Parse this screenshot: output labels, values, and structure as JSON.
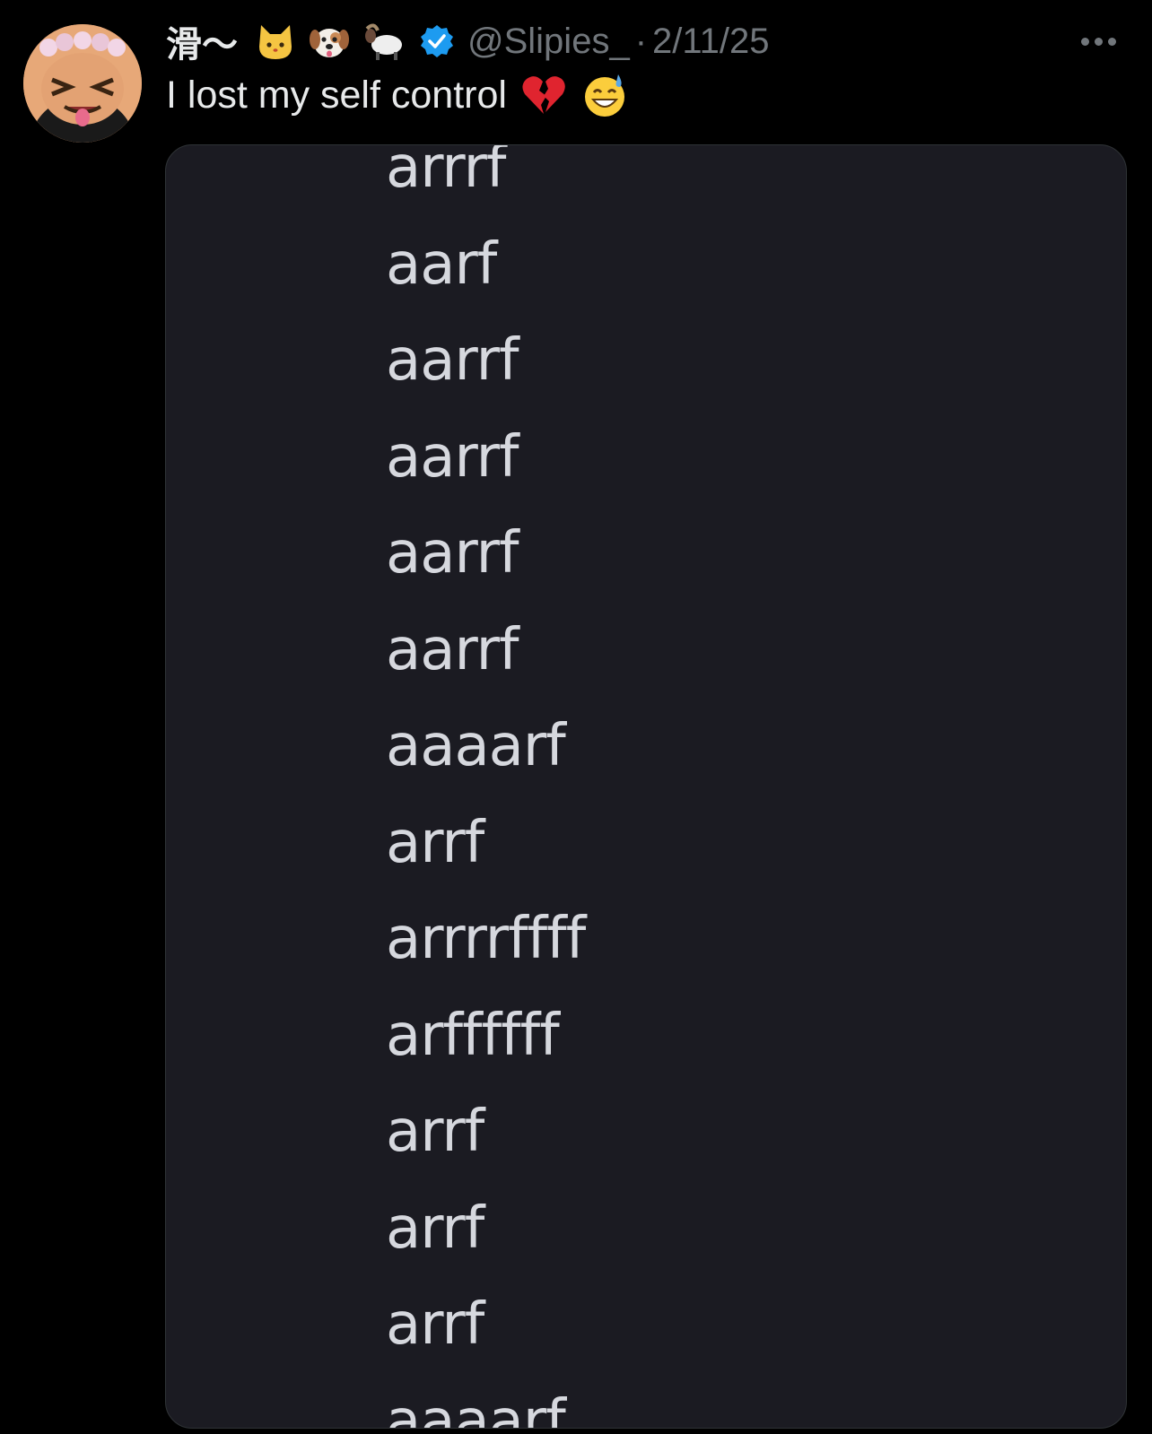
{
  "post": {
    "avatar_icon": "avatar-icon",
    "display_name": "滑〜",
    "name_emojis": [
      "cat-face-icon",
      "dog-face-icon",
      "ram-icon"
    ],
    "verified_icon": "verified-badge-icon",
    "handle": "@Slipies_",
    "separator": "·",
    "date": "2/11/25",
    "more_icon": "more-options-icon",
    "text": "I lost my self control",
    "text_emojis": [
      "broken-heart-icon",
      "grinning-sweat-icon"
    ]
  },
  "media": {
    "lines": [
      "arrrf",
      "aarf",
      "aarrf",
      "aarrf",
      "aarrf",
      "aarrf",
      "aaaarf",
      "arrf",
      "arrrrffff",
      "arffffff",
      "arrf",
      "arrf",
      "arrf",
      "aaaarf"
    ]
  },
  "colors": {
    "background": "#000000",
    "primary_text": "#e7e9ea",
    "secondary_text": "#71767b",
    "media_background": "#1b1b22",
    "verified_blue": "#1d9bf0"
  }
}
